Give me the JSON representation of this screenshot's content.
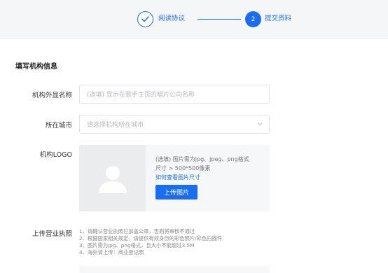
{
  "steps": [
    {
      "label": "阅读协议",
      "state": "done",
      "icon": "check-icon"
    },
    {
      "label": "提交资料",
      "state": "active",
      "number": "2"
    }
  ],
  "section_title": "填写机构信息",
  "fields": {
    "display_name": {
      "label": "机构外显名称",
      "placeholder": "(选填) 显示在歌手主页的唱片公司名称"
    },
    "city": {
      "label": "所在城市",
      "placeholder": "请选择机构所在城市",
      "icon": "chevron-down-icon"
    },
    "logo": {
      "label": "机构LOGO",
      "hint_line1": "(选填) 图片需为jpg、jpeg、png格式",
      "hint_line2": "尺寸 > 500*500像素",
      "size_link": "如何查看图片尺寸",
      "upload_label": "上传图片",
      "placeholder_icon": "user-silhouette-icon"
    },
    "license": {
      "label": "上传营业执照",
      "notes": [
        "1、请确认营业执照已加盖公章，否则将审核不通过",
        "2、根据国家相关规定，请提供有效身份的彩色照片/彩色扫描件",
        "3、图片需为jpg、png格式，且大小不能超过3.5M",
        "4、海外请上传：商业登记照"
      ]
    }
  },
  "colors": {
    "accent": "#1a6df0",
    "panel": "#f6f7f9",
    "header_bg": "#f5f6f7"
  }
}
